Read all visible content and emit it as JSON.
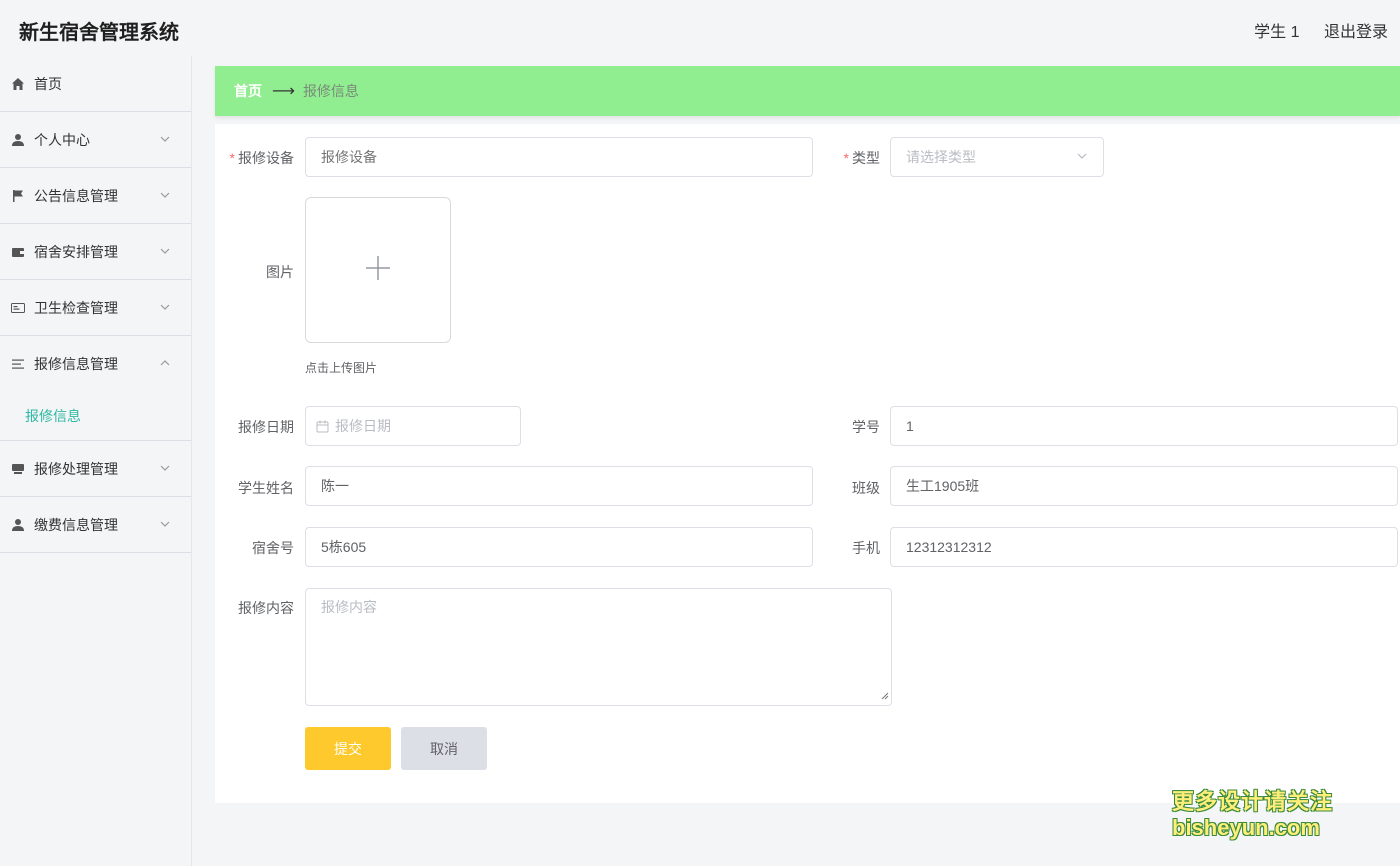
{
  "app": {
    "title": "新生宿舍管理系统"
  },
  "user": {
    "name": "学生 1",
    "logout": "退出登录"
  },
  "sidebar": {
    "items": [
      {
        "label": "首页",
        "icon": "home-icon"
      },
      {
        "label": "个人中心",
        "icon": "user-icon"
      },
      {
        "label": "公告信息管理",
        "icon": "flag-icon"
      },
      {
        "label": "宿舍安排管理",
        "icon": "wallet-icon"
      },
      {
        "label": "卫生检查管理",
        "icon": "id-card-icon"
      },
      {
        "label": "报修信息管理",
        "icon": "list-icon",
        "sub": [
          {
            "label": "报修信息"
          }
        ]
      },
      {
        "label": "报修处理管理",
        "icon": "tray-icon"
      },
      {
        "label": "缴费信息管理",
        "icon": "user-icon"
      }
    ]
  },
  "breadcrumb": {
    "home": "首页",
    "current": "报修信息"
  },
  "form": {
    "device": {
      "label": "报修设备",
      "placeholder": "报修设备"
    },
    "type": {
      "label": "类型",
      "placeholder": "请选择类型"
    },
    "image": {
      "label": "图片",
      "tip": "点击上传图片"
    },
    "date": {
      "label": "报修日期",
      "placeholder": "报修日期"
    },
    "student_no": {
      "label": "学号",
      "value": "1"
    },
    "student_name": {
      "label": "学生姓名",
      "value": "陈一"
    },
    "class": {
      "label": "班级",
      "value": "生工1905班"
    },
    "dorm": {
      "label": "宿舍号",
      "value": "5栋605"
    },
    "phone": {
      "label": "手机",
      "value": "12312312312"
    },
    "content": {
      "label": "报修内容",
      "placeholder": "报修内容"
    },
    "submit": "提交",
    "cancel": "取消"
  },
  "watermark": {
    "line1": "更多设计请关注",
    "line2": "bisheyun.com"
  },
  "colors": {
    "breadcrumb_bg": "#90ee90",
    "submit_bg": "#fdc92c",
    "active_sub": "#2fb9a3",
    "required": "#f56c6c"
  }
}
